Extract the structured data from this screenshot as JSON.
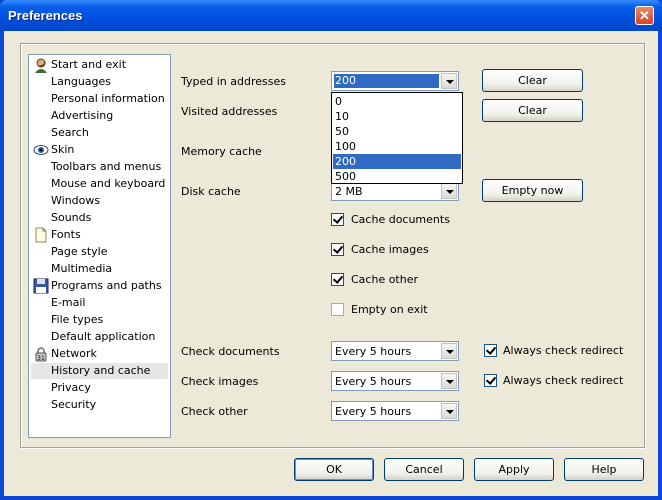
{
  "window": {
    "title": "Preferences",
    "close_glyph": "✕"
  },
  "sidebar": {
    "items": [
      {
        "label": "Start and exit",
        "icon": "user-icon"
      },
      {
        "label": "Languages"
      },
      {
        "label": "Personal information"
      },
      {
        "label": "Advertising"
      },
      {
        "label": "Search"
      },
      {
        "label": "Skin",
        "icon": "eye-icon"
      },
      {
        "label": "Toolbars and menus"
      },
      {
        "label": "Mouse and keyboard"
      },
      {
        "label": "Windows"
      },
      {
        "label": "Sounds"
      },
      {
        "label": "Fonts",
        "icon": "document-icon"
      },
      {
        "label": "Page style"
      },
      {
        "label": "Multimedia"
      },
      {
        "label": "Programs and paths",
        "icon": "floppy-icon"
      },
      {
        "label": "E-mail"
      },
      {
        "label": "File types"
      },
      {
        "label": "Default application"
      },
      {
        "label": "Network",
        "icon": "lock-icon"
      },
      {
        "label": "History and cache",
        "selected": true
      },
      {
        "label": "Privacy"
      },
      {
        "label": "Security"
      }
    ]
  },
  "main": {
    "typed_label": "Typed in addresses",
    "typed_value": "200",
    "typed_options": [
      "0",
      "10",
      "50",
      "100",
      "200",
      "500"
    ],
    "typed_selected_index": 4,
    "visited_label": "Visited addresses",
    "memory_label": "Memory cache",
    "disk_label": "Disk cache",
    "disk_value": "2 MB",
    "clear_typed": "Clear",
    "clear_visited": "Clear",
    "empty_now": "Empty now",
    "cache_documents": "Cache documents",
    "cache_images": "Cache images",
    "cache_other": "Cache other",
    "empty_on_exit": "Empty on exit",
    "check_documents_label": "Check documents",
    "check_documents_value": "Every 5 hours",
    "check_images_label": "Check images",
    "check_images_value": "Every 5 hours",
    "check_other_label": "Check other",
    "check_other_value": "Every 5 hours",
    "always_redirect_1": "Always check redirect",
    "always_redirect_2": "Always check redirect"
  },
  "footer": {
    "ok": "OK",
    "cancel": "Cancel",
    "apply": "Apply",
    "help": "Help"
  },
  "colors": {
    "title_blue": "#0050e0",
    "selection": "#316ac5",
    "dialog_bg": "#ece9d8"
  }
}
